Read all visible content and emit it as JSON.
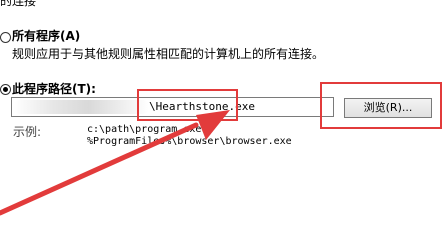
{
  "top_fragment": "的连接",
  "all_programs": {
    "label": "所有程序(A)",
    "description": "规则应用于与其他规则属性相匹配的计算机上的所有连接。"
  },
  "this_program_path": {
    "label": "此程序路径(T):",
    "input_value": "\\Hearthstone.exe",
    "browse_button": "浏览(R)..."
  },
  "example": {
    "label": "示例:",
    "line1": "c:\\path\\program.exe",
    "line2": "%ProgramFiles%\\browser\\browser.exe"
  },
  "annotation_color": "#e23b3b"
}
